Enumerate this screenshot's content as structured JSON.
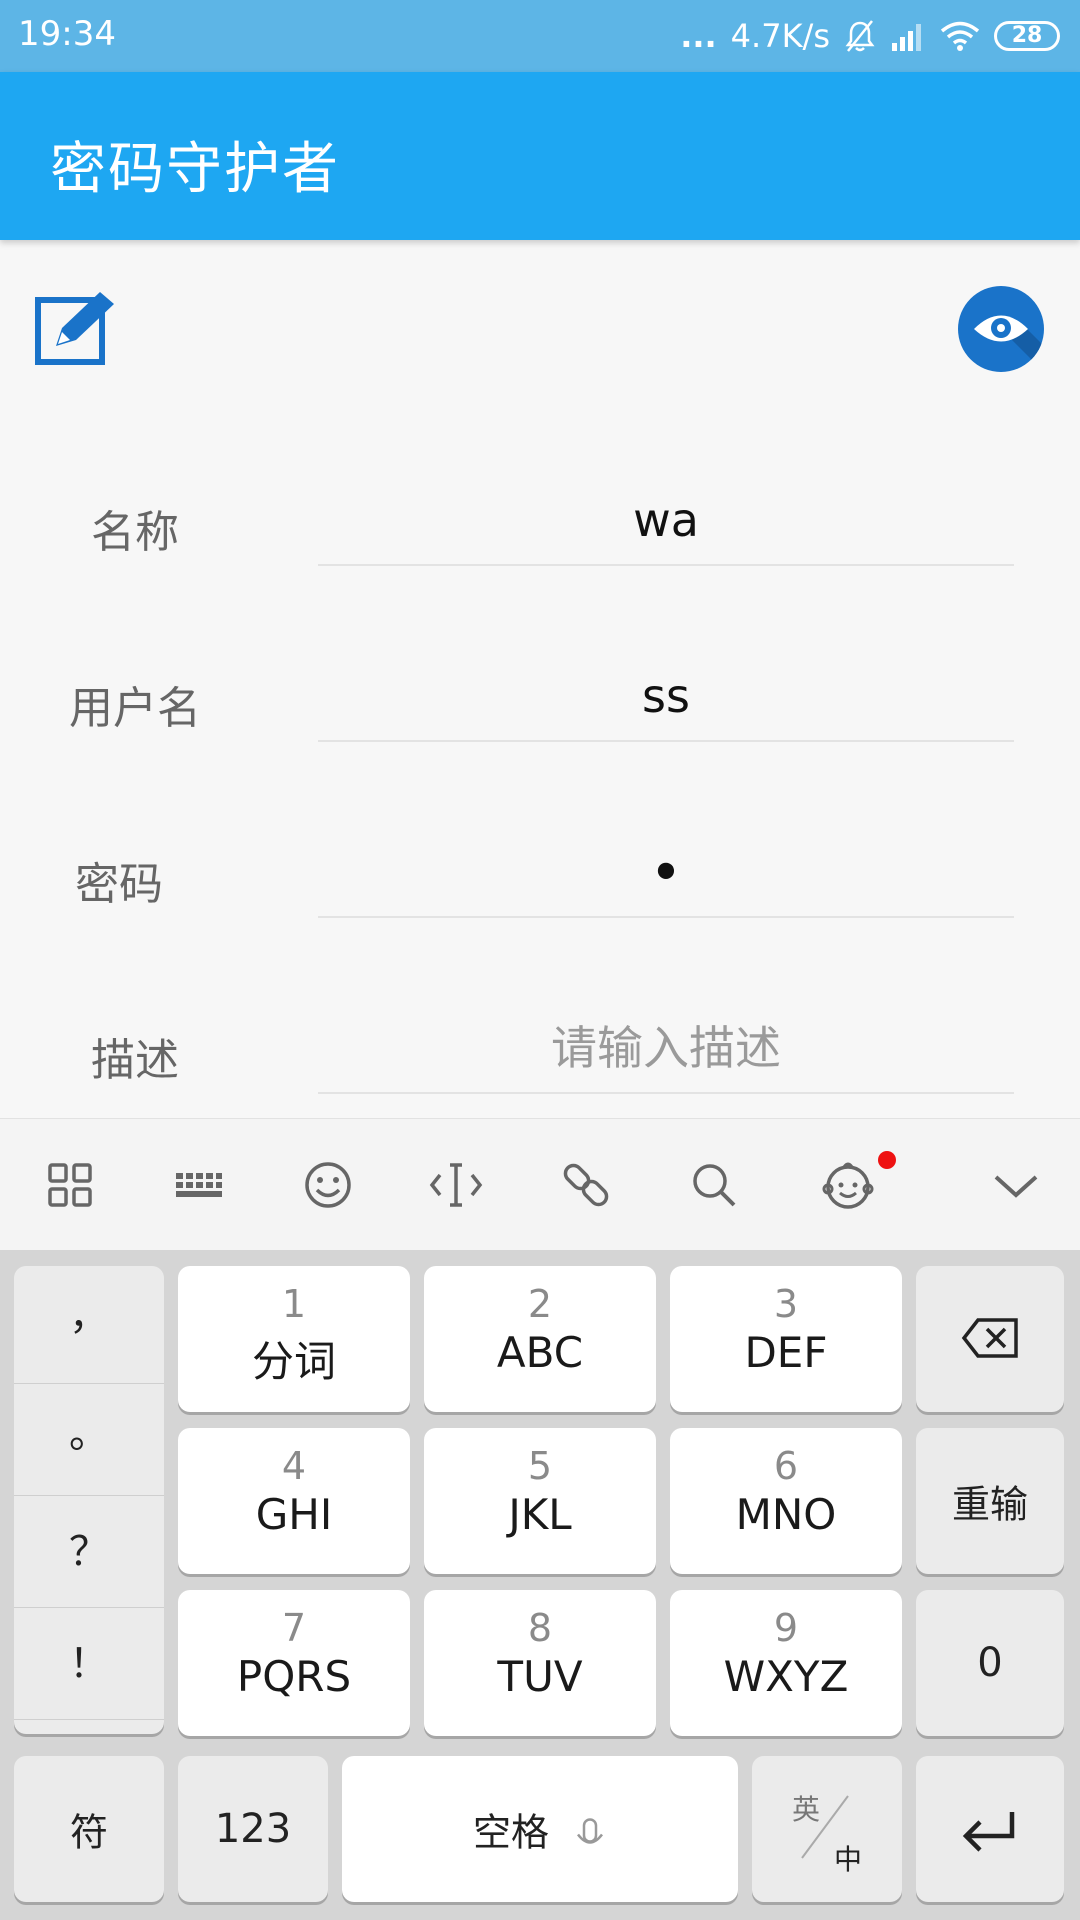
{
  "status_bar": {
    "time": "19:34",
    "more": "...",
    "net_speed": "4.7K/s",
    "battery": "28",
    "icons": [
      "bell-muted-icon",
      "signal-icon",
      "wifi-icon",
      "battery-icon"
    ]
  },
  "app_bar": {
    "title": "密码守护者"
  },
  "toolbar": {
    "edit_icon": "edit-icon",
    "reveal_icon": "eye-icon",
    "accent": "#1a73c9"
  },
  "form": {
    "name": {
      "label": "名称",
      "value": "wa"
    },
    "username": {
      "label": "用户名",
      "value": "ss"
    },
    "password": {
      "label": "密码",
      "value": "•"
    },
    "description": {
      "label": "描述",
      "placeholder": "请输入描述"
    }
  },
  "keyboard_toolbar": {
    "icons": [
      "grid-icon",
      "keyboard-icon",
      "emoji-icon",
      "cursor-icon",
      "link-icon",
      "search-icon",
      "baby-face-icon",
      "chevron-down-icon"
    ],
    "notification_color": "#ee1111"
  },
  "keyboard": {
    "punctuation": [
      "，",
      "。",
      "？",
      "！"
    ],
    "keys": [
      {
        "num": "1",
        "letters": "分词"
      },
      {
        "num": "2",
        "letters": "ABC"
      },
      {
        "num": "3",
        "letters": "DEF"
      },
      {
        "num": "4",
        "letters": "GHI"
      },
      {
        "num": "5",
        "letters": "JKL"
      },
      {
        "num": "6",
        "letters": "MNO"
      },
      {
        "num": "7",
        "letters": "PQRS"
      },
      {
        "num": "8",
        "letters": "TUV"
      },
      {
        "num": "9",
        "letters": "WXYZ"
      }
    ],
    "reset": "重输",
    "zero": "0",
    "symbols": "符",
    "numeric": "123",
    "space": "空格",
    "lang_top": "英",
    "lang_bottom": "中"
  },
  "colors": {
    "app_bar": "#1ea7f2",
    "status_bar": "#5db5e6"
  }
}
